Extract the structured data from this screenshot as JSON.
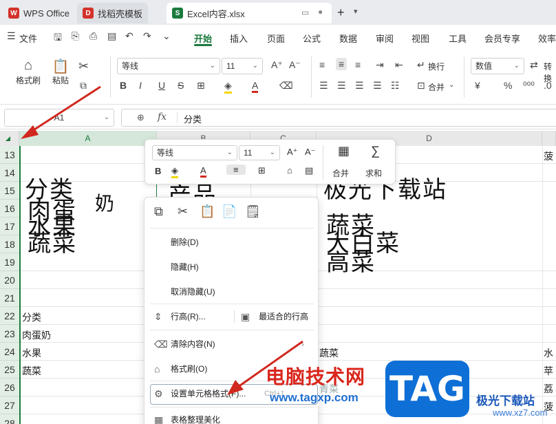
{
  "tabs": [
    {
      "label": "WPS Office",
      "logo": "W"
    },
    {
      "label": "找稻壳模板",
      "logo": "D"
    },
    {
      "label": "Excel内容.xlsx",
      "logo": "S"
    }
  ],
  "menu": {
    "file": "文件",
    "items": [
      "开始",
      "插入",
      "页面",
      "公式",
      "数据",
      "审阅",
      "视图",
      "工具",
      "会员专享",
      "效率"
    ]
  },
  "ribbon": {
    "format_painter": "格式刷",
    "paste": "粘贴",
    "font_name": "等线",
    "font_size": "11",
    "wrap": "换行",
    "merge": "合并",
    "number_format": "数值",
    "convert": "转换",
    "currency": "¥",
    "percent": "%"
  },
  "formula_bar": {
    "name_box": "A1",
    "fx": "fx",
    "value": "分类"
  },
  "columns": [
    "A",
    "B",
    "C",
    "D"
  ],
  "rows": [
    "13",
    "14",
    "15",
    "16",
    "17",
    "18",
    "19",
    "20",
    "21",
    "22",
    "23",
    "24",
    "25",
    "26",
    "27",
    "28"
  ],
  "cells": {
    "a22": "分类",
    "a23": "肉蛋奶",
    "a24": "水果",
    "a25": "蔬菜",
    "d24": "蔬菜",
    "d26": "青菜",
    "e13": "菠",
    "e24": "水",
    "e25": "苹",
    "e26": "荔",
    "e27": "菠"
  },
  "big_text": {
    "a_line1": "分类",
    "a_line1b": "奶",
    "a_line2": "肉蛋",
    "a_line3": "水果",
    "a_line4": "蔬菜",
    "b_line1": "产品",
    "d_line1": "极光下载站",
    "d_line2": "蔬菜",
    "d_line3": "大白菜",
    "d_line4": "高菜"
  },
  "mini_toolbar": {
    "font_name": "等线",
    "font_size": "11",
    "merge": "合并",
    "sum": "求和"
  },
  "context_menu": {
    "items": [
      {
        "label": "删除(D)"
      },
      {
        "label": "隐藏(H)"
      },
      {
        "label": "取消隐藏(U)"
      },
      {
        "label": "行高(R)..."
      },
      {
        "label": "最适合的行高"
      },
      {
        "label": "清除内容(N)"
      },
      {
        "label": "格式刷(O)"
      },
      {
        "label": "设置单元格格式(F)...",
        "shortcut": "Ctrl+1"
      },
      {
        "label": "表格整理美化"
      }
    ]
  },
  "watermark": {
    "site_cn": "电脑技术网",
    "site_url": "www.tagxp.com",
    "tag": "TAG",
    "jg": "极光下载站",
    "xz7": "www.xz7.com"
  },
  "colors": {
    "accent": "#1a7a3d",
    "arrow": "#d0281e",
    "row_header": "#e3efe6"
  }
}
